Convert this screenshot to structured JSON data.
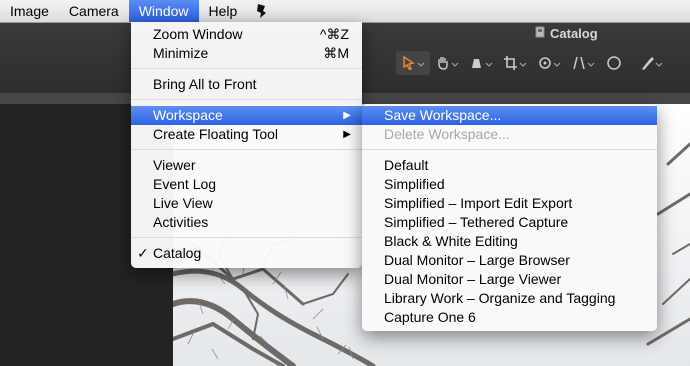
{
  "menubar": {
    "items": [
      "Image",
      "Camera",
      "Window",
      "Help"
    ]
  },
  "window_title": "Catalog",
  "window_menu": {
    "zoom": "Zoom Window",
    "zoom_shortcut": "^⌘Z",
    "minimize": "Minimize",
    "minimize_shortcut": "⌘M",
    "bring_all": "Bring All to Front",
    "workspace": "Workspace",
    "floating_tool": "Create Floating Tool",
    "viewer": "Viewer",
    "event_log": "Event Log",
    "live_view": "Live View",
    "activities": "Activities",
    "catalog": "Catalog",
    "check": "✓",
    "submenu_arrow": "▶"
  },
  "workspace_menu": {
    "save": "Save Workspace...",
    "delete": "Delete Workspace...",
    "items": [
      "Default",
      "Simplified",
      "Simplified – Import Edit Export",
      "Simplified – Tethered Capture",
      "Black & White Editing",
      "Dual Monitor – Large Browser",
      "Dual Monitor – Large Viewer",
      "Library Work – Organize and Tagging",
      "Capture One 6"
    ]
  },
  "toolbar_icons": [
    "pointer-icon",
    "hand-icon",
    "crop-frame-icon",
    "crop-icon",
    "rotate-icon",
    "keystone-icon",
    "spot-icon",
    "color-picker-icon"
  ],
  "colors": {
    "highlight": "#2e62e2",
    "tool_selected": "#e8892e"
  }
}
